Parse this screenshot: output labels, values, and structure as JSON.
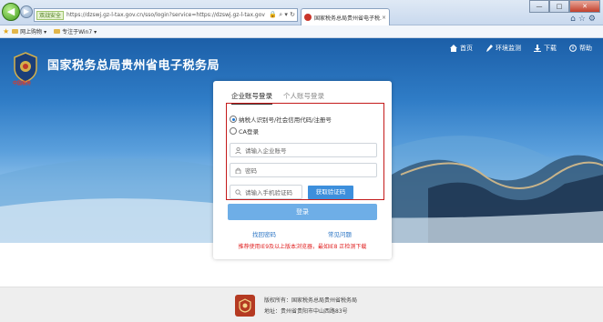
{
  "browser": {
    "address_tag": "双战安全",
    "url": "https://dzswj.gz-l-tax.gov.cn/sso/login?service=https://dzswj.gz-l-tax.gov",
    "tab_title": "国家税务总局贵州省电子税...",
    "tab_close": "×",
    "win_min": "—",
    "win_max": "□",
    "win_close": "✕",
    "favorites": [
      "网上购物 ▾",
      "专注于Win7 ▾"
    ]
  },
  "site": {
    "title": "国家税务总局贵州省电子税务局",
    "logo_caption": "中国税务",
    "nav": {
      "home": "首页",
      "env_check": "环境监测",
      "download": "下载",
      "help": "帮助"
    }
  },
  "login": {
    "tabs": {
      "enterprise": "企业账号登录",
      "personal": "个人账号登录"
    },
    "radio_taxpayer": "纳税人识别号/社会信用代码/注册号",
    "radio_ca": "CA登录",
    "account_placeholder": "请输入企业账号",
    "password_placeholder": "密码",
    "phone_placeholder": "请输入手机验证码",
    "sms_button": "获取验证码",
    "login_button": "登录",
    "forgot_password": "找回密码",
    "faq": "常见问题",
    "notice": "推荐使用IE9及以上版本浏览器，最如IE8 正检测下载"
  },
  "footer": {
    "copyright": "版权所有：国家税务总局贵州省税务局",
    "address": "地址：贵州省贵阳市中山西路83号"
  },
  "colors": {
    "accent": "#3d8fdc",
    "alert": "#c41a1a"
  }
}
